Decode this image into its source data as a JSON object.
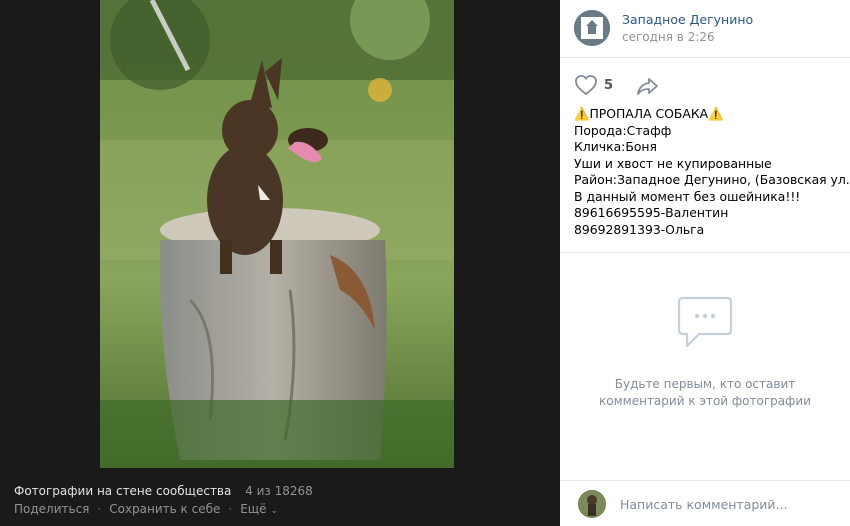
{
  "viewer": {
    "album_title": "Фотографии на стене сообщества",
    "photo_counter": "4 из 18268",
    "actions": {
      "share": "Поделиться",
      "save": "Сохранить к себе",
      "more": "Ещё"
    }
  },
  "post": {
    "author": "Западное Дегунино",
    "date": "сегодня в 2:26",
    "likes": "5",
    "lines": [
      "ПРОПАЛА СОБАКА",
      "Порода:Стафф",
      "Кличка:Боня",
      "Уши и хвост не купированные",
      "Район:Западное Дегунино, (Базовская ул.)",
      "В данный момент без ошейника!!!",
      "89616695595-Валентин",
      "89692891393-Ольга"
    ]
  },
  "comments": {
    "empty_line1": "Будьте первым, кто оставит",
    "empty_line2": "комментарий к этой фотографии",
    "input_placeholder": "Написать комментарий..."
  },
  "colors": {
    "link": "#2a5885",
    "muted": "#939393",
    "dark_bg": "#1a1a1a"
  }
}
